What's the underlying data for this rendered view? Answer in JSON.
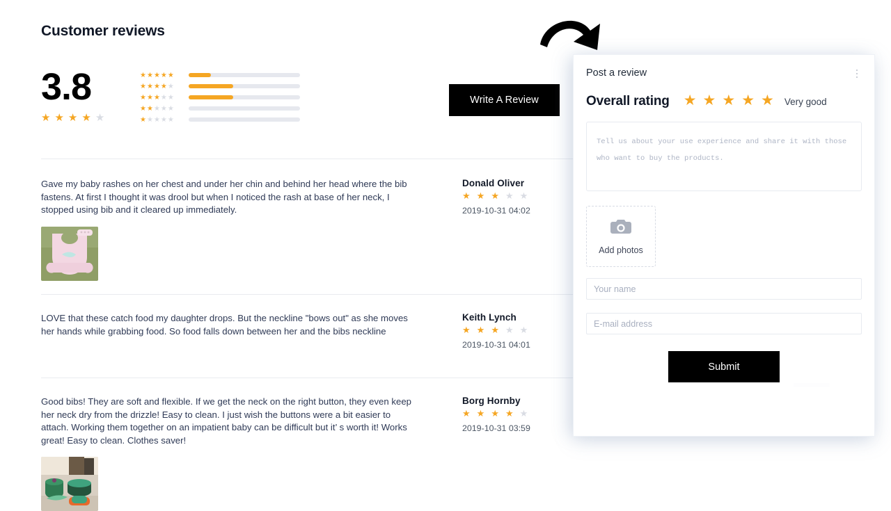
{
  "page": {
    "title": "Customer reviews",
    "summary": {
      "score": "3.8",
      "score_stars_filled": 4,
      "distribution": [
        {
          "stars": 5,
          "percent": 20
        },
        {
          "stars": 4,
          "percent": 40
        },
        {
          "stars": 3,
          "percent": 40
        },
        {
          "stars": 2,
          "percent": 0
        },
        {
          "stars": 1,
          "percent": 0
        }
      ]
    },
    "write_review_label": "Write A Review",
    "reviews": [
      {
        "text": "Gave my baby rashes on her chest and under her chin and behind her head where the bib fastens. At first I thought it was drool but when I noticed the rash at base of her neck, I stopped using bib and it cleared up immediately.",
        "author": "Donald Oliver",
        "rating": 3,
        "date": "2019-10-31 04:02",
        "has_photo": true,
        "photo_alt": "pink-baby-bib-photo"
      },
      {
        "text": "LOVE that these catch food my daughter drops. But the neckline \"bows out\" as she moves her hands while grabbing food. So food falls down between her and the bibs neckline",
        "author": "Keith Lynch",
        "rating": 3,
        "date": "2019-10-31 04:01",
        "has_photo": false,
        "photo_alt": ""
      },
      {
        "text": "Good bibs! They are soft and flexible. If we get the neck on the right button, they even keep her neck dry from the drizzle! Easy to clean. I just wish the buttons were a bit easier to attach. Working them together on an impatient baby can be difficult but it’ s worth it! Works great! Easy to clean. Clothes saver!",
        "author": "Borg Hornby",
        "rating": 4,
        "date": "2019-10-31 03:59",
        "has_photo": true,
        "photo_alt": "green-baby-feeding-set-photo"
      }
    ]
  },
  "panel": {
    "title": "Post a review",
    "menu_icon": "kebab-menu-icon",
    "overall": {
      "label": "Overall rating",
      "stars_selected": 5,
      "caption": "Very good"
    },
    "textarea": {
      "placeholder": "Tell us about your use experience and share it with those who want to buy the products.",
      "value": ""
    },
    "add_photos": {
      "label": "Add photos",
      "icon": "camera-icon"
    },
    "name_field": {
      "placeholder": "Your name",
      "value": ""
    },
    "email_field": {
      "placeholder": "E-mail address",
      "value": ""
    },
    "submit_label": "Submit"
  },
  "decoration": {
    "arrow": "curved-arrow-icon"
  },
  "colors": {
    "star_filled": "#f5a623",
    "star_empty": "#d9dce3",
    "button_bg": "#000000",
    "text_body": "#2f3a56"
  }
}
